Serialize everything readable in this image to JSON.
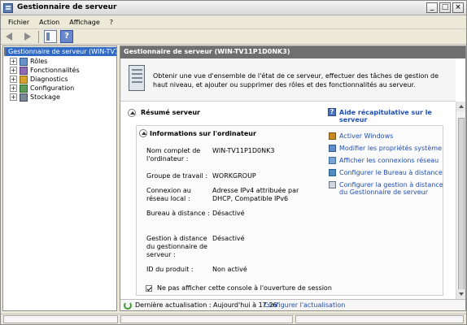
{
  "window": {
    "title": "Gestionnaire de serveur",
    "minimize": "_",
    "maximize": "□",
    "close": "×"
  },
  "menu": {
    "items": [
      "Fichier",
      "Action",
      "Affichage",
      "?"
    ]
  },
  "tree": {
    "items": [
      {
        "label": "Gestionnaire de serveur (WIN-TV1",
        "selected": true
      },
      {
        "label": "Rôles"
      },
      {
        "label": "Fonctionnalités"
      },
      {
        "label": "Diagnostics"
      },
      {
        "label": "Configuration"
      },
      {
        "label": "Stockage"
      }
    ]
  },
  "main": {
    "header": "Gestionnaire de serveur (WIN-TV11P1D0NK3)",
    "intro_text": "Obtenir une vue d'ensemble de l'état de ce serveur, effectuer des tâches de gestion de haut niveau, et ajouter ou supprimer des rôles et des fonctionnalités au serveur.",
    "summary_title": "Résumé serveur",
    "summary_help": "Aide récapitulative sur le serveur",
    "info_title": "Informations sur l'ordinateur",
    "info_rows": [
      {
        "label": "Nom complet de l'ordinateur :",
        "value": "WIN-TV11P1D0NK3"
      },
      {
        "label": "Groupe de travail :",
        "value": "WORKGROUP"
      },
      {
        "label": "Connexion au réseau local :",
        "value": "Adresse IPv4 attribuée par DHCP, Compatible IPv6"
      },
      {
        "label": "Bureau à distance :",
        "value": "Désactivé"
      },
      {
        "label": "Gestion à distance du gestionnaire de serveur :",
        "value": "Désactivé"
      },
      {
        "label": "ID du produit :",
        "value": "Non activé"
      }
    ],
    "actions": [
      "Activer Windows",
      "Modifier les propriétés système",
      "Afficher les connexions réseau",
      "Configurer le Bureau à distance",
      "Configurer la gestion à distance du Gestionnaire de serveur"
    ],
    "checkbox_label": "Ne pas afficher cette console à l'ouverture de session",
    "footer_status": "Dernière actualisation : Aujourd'hui à 17:26",
    "footer_link": "Configurer l'actualisation"
  }
}
